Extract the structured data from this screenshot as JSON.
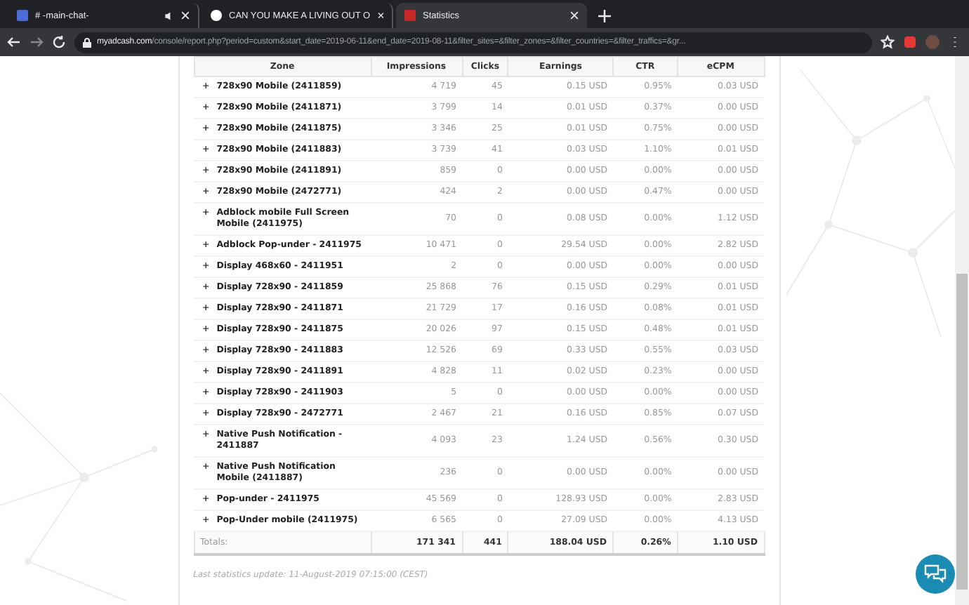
{
  "browser": {
    "tabs": [
      {
        "title": "# -main-chat-",
        "selected": false,
        "muted": true
      },
      {
        "title": "CAN YOU MAKE A LIVING OUT O",
        "selected": false,
        "muted": false
      },
      {
        "title": "Statistics",
        "selected": true,
        "muted": false
      }
    ],
    "address": {
      "domain": "myadcash.com",
      "path": "/console/report.php?period=custom&start_date=2019-06-11&end_date=2019-08-11&filter_sites=&filter_zones=&filter_countries=&filter_traffics=&gr..."
    }
  },
  "table": {
    "columns": [
      "Zone",
      "Impressions",
      "Clicks",
      "Earnings",
      "CTR",
      "eCPM"
    ],
    "rows": [
      {
        "expander": "+",
        "zone": "728x90 Mobile (2411859)",
        "impressions": "4 719",
        "clicks": "45",
        "earnings": "0.15 USD",
        "ctr": "0.95%",
        "ecpm": "0.03 USD"
      },
      {
        "expander": "+",
        "zone": "728x90 Mobile (2411871)",
        "impressions": "3 799",
        "clicks": "14",
        "earnings": "0.01 USD",
        "ctr": "0.37%",
        "ecpm": "0.00 USD"
      },
      {
        "expander": "+",
        "zone": "728x90 Mobile (2411875)",
        "impressions": "3 346",
        "clicks": "25",
        "earnings": "0.01 USD",
        "ctr": "0.75%",
        "ecpm": "0.00 USD"
      },
      {
        "expander": "+",
        "zone": "728x90 Mobile (2411883)",
        "impressions": "3 739",
        "clicks": "41",
        "earnings": "0.03 USD",
        "ctr": "1.10%",
        "ecpm": "0.01 USD"
      },
      {
        "expander": "+",
        "zone": "728x90 Mobile (2411891)",
        "impressions": "859",
        "clicks": "0",
        "earnings": "0.00 USD",
        "ctr": "0.00%",
        "ecpm": "0.00 USD"
      },
      {
        "expander": "+",
        "zone": "728x90 Mobile (2472771)",
        "impressions": "424",
        "clicks": "2",
        "earnings": "0.00 USD",
        "ctr": "0.47%",
        "ecpm": "0.00 USD"
      },
      {
        "expander": "+",
        "zone": "Adblock mobile Full Screen Mobile (2411975)",
        "impressions": "70",
        "clicks": "0",
        "earnings": "0.08 USD",
        "ctr": "0.00%",
        "ecpm": "1.12 USD"
      },
      {
        "expander": "+",
        "zone": "Adblock Pop-under - 2411975",
        "impressions": "10 471",
        "clicks": "0",
        "earnings": "29.54 USD",
        "ctr": "0.00%",
        "ecpm": "2.82 USD"
      },
      {
        "expander": "+",
        "zone": "Display 468x60 - 2411951",
        "impressions": "2",
        "clicks": "0",
        "earnings": "0.00 USD",
        "ctr": "0.00%",
        "ecpm": "0.00 USD"
      },
      {
        "expander": "+",
        "zone": "Display 728x90 - 2411859",
        "impressions": "25 868",
        "clicks": "76",
        "earnings": "0.15 USD",
        "ctr": "0.29%",
        "ecpm": "0.01 USD"
      },
      {
        "expander": "+",
        "zone": "Display 728x90 - 2411871",
        "impressions": "21 729",
        "clicks": "17",
        "earnings": "0.16 USD",
        "ctr": "0.08%",
        "ecpm": "0.01 USD"
      },
      {
        "expander": "+",
        "zone": "Display 728x90 - 2411875",
        "impressions": "20 026",
        "clicks": "97",
        "earnings": "0.15 USD",
        "ctr": "0.48%",
        "ecpm": "0.01 USD"
      },
      {
        "expander": "+",
        "zone": "Display 728x90 - 2411883",
        "impressions": "12 526",
        "clicks": "69",
        "earnings": "0.33 USD",
        "ctr": "0.55%",
        "ecpm": "0.03 USD"
      },
      {
        "expander": "+",
        "zone": "Display 728x90 - 2411891",
        "impressions": "4 828",
        "clicks": "11",
        "earnings": "0.02 USD",
        "ctr": "0.23%",
        "ecpm": "0.00 USD"
      },
      {
        "expander": "+",
        "zone": "Display 728x90 - 2411903",
        "impressions": "5",
        "clicks": "0",
        "earnings": "0.00 USD",
        "ctr": "0.00%",
        "ecpm": "0.00 USD"
      },
      {
        "expander": "+",
        "zone": "Display 728x90 - 2472771",
        "impressions": "2 467",
        "clicks": "21",
        "earnings": "0.16 USD",
        "ctr": "0.85%",
        "ecpm": "0.07 USD"
      },
      {
        "expander": "+",
        "zone": "Native Push Notification - 2411887",
        "impressions": "4 093",
        "clicks": "23",
        "earnings": "1.24 USD",
        "ctr": "0.56%",
        "ecpm": "0.30 USD"
      },
      {
        "expander": "+",
        "zone": "Native Push Notification Mobile (2411887)",
        "impressions": "236",
        "clicks": "0",
        "earnings": "0.00 USD",
        "ctr": "0.00%",
        "ecpm": "0.00 USD"
      },
      {
        "expander": "+",
        "zone": "Pop-under - 2411975",
        "impressions": "45 569",
        "clicks": "0",
        "earnings": "128.93 USD",
        "ctr": "0.00%",
        "ecpm": "2.83 USD"
      },
      {
        "expander": "+",
        "zone": "Pop-Under mobile (2411975)",
        "impressions": "6 565",
        "clicks": "0",
        "earnings": "27.09 USD",
        "ctr": "0.00%",
        "ecpm": "4.13 USD"
      }
    ],
    "totals": {
      "label": "Totals:",
      "impressions": "171 341",
      "clicks": "441",
      "earnings": "188.04 USD",
      "ctr": "0.26%",
      "ecpm": "1.10 USD"
    }
  },
  "footnote": "Last statistics update: 11-August-2019 07:15:00 (CEST)"
}
